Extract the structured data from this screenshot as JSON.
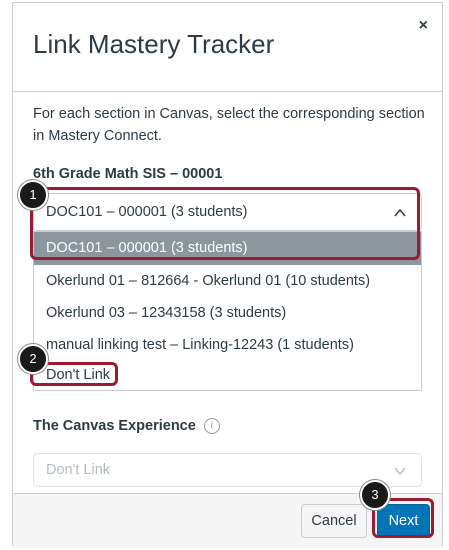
{
  "modal": {
    "title": "Link Mastery Tracker",
    "close_label": "×",
    "description": "For each section in Canvas, select the corresponding section in Mastery Connect."
  },
  "section": {
    "label": "6th Grade Math SIS – 00001",
    "selected_value": "DOC101 – 000001 (3 students)",
    "options": [
      "DOC101 – 000001 (3 students)",
      "Okerlund 01 – 812664 - Okerlund 01 (10 students)",
      "Okerlund 03 – 12343158 (3 students)",
      "manual linking test – Linking-12243 (1 students)",
      "Don't Link"
    ]
  },
  "canvas_experience": {
    "label": "The Canvas Experience",
    "info_icon": "i",
    "placeholder": "Don't Link"
  },
  "footer": {
    "cancel_label": "Cancel",
    "next_label": "Next"
  },
  "callouts": [
    "1",
    "2",
    "3"
  ],
  "colors": {
    "accent": "#0374b5",
    "highlight": "#9b1b30",
    "selected_option": "#8b969e"
  }
}
